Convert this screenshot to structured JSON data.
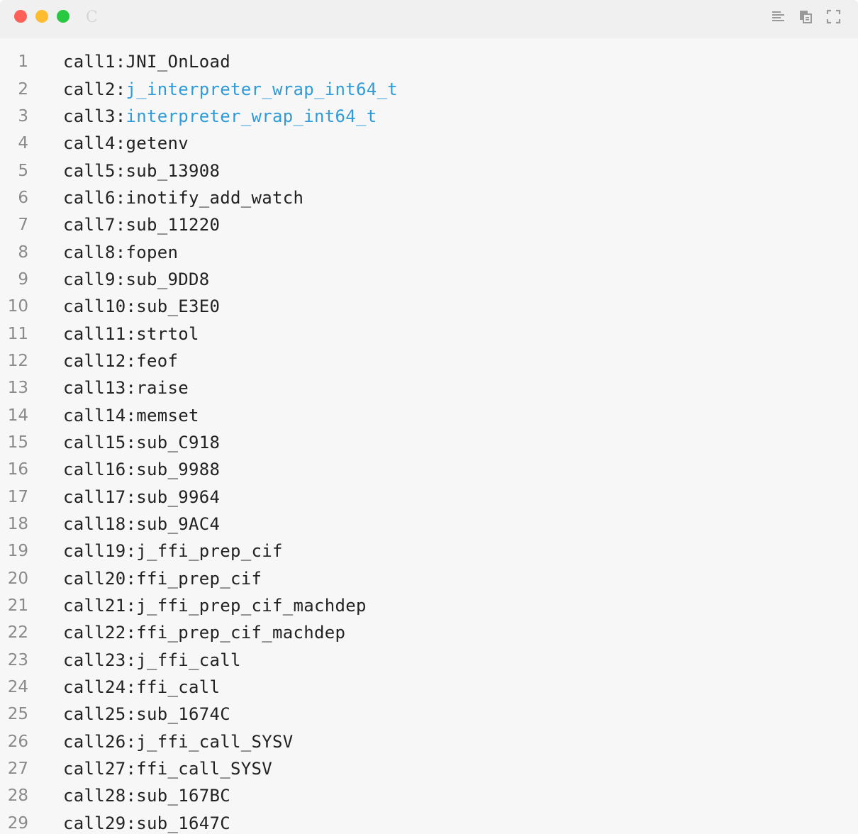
{
  "window": {
    "language_label": "C",
    "toolbar": {
      "icons": [
        "align-left-icon",
        "copy-icon",
        "fullscreen-icon"
      ]
    }
  },
  "colors": {
    "highlight": "#2f9bd9",
    "text": "#222222",
    "line_number": "#8a8a8a",
    "background": "#f7f7f7"
  },
  "code": {
    "lines": [
      {
        "num": "1",
        "prefix": "call1:",
        "name": "JNI_OnLoad",
        "highlight": false
      },
      {
        "num": "2",
        "prefix": "call2:",
        "name": "j_interpreter_wrap_int64_t",
        "highlight": true
      },
      {
        "num": "3",
        "prefix": "call3:",
        "name": "interpreter_wrap_int64_t",
        "highlight": true
      },
      {
        "num": "4",
        "prefix": "call4:",
        "name": "getenv",
        "highlight": false
      },
      {
        "num": "5",
        "prefix": "call5:",
        "name": "sub_13908",
        "highlight": false
      },
      {
        "num": "6",
        "prefix": "call6:",
        "name": "inotify_add_watch",
        "highlight": false
      },
      {
        "num": "7",
        "prefix": "call7:",
        "name": "sub_11220",
        "highlight": false
      },
      {
        "num": "8",
        "prefix": "call8:",
        "name": "fopen",
        "highlight": false
      },
      {
        "num": "9",
        "prefix": "call9:",
        "name": "sub_9DD8",
        "highlight": false
      },
      {
        "num": "10",
        "prefix": "call10:",
        "name": "sub_E3E0",
        "highlight": false
      },
      {
        "num": "11",
        "prefix": "call11:",
        "name": "strtol",
        "highlight": false
      },
      {
        "num": "12",
        "prefix": "call12:",
        "name": "feof",
        "highlight": false
      },
      {
        "num": "13",
        "prefix": "call13:",
        "name": "raise",
        "highlight": false
      },
      {
        "num": "14",
        "prefix": "call14:",
        "name": "memset",
        "highlight": false
      },
      {
        "num": "15",
        "prefix": "call15:",
        "name": "sub_C918",
        "highlight": false
      },
      {
        "num": "16",
        "prefix": "call16:",
        "name": "sub_9988",
        "highlight": false
      },
      {
        "num": "17",
        "prefix": "call17:",
        "name": "sub_9964",
        "highlight": false
      },
      {
        "num": "18",
        "prefix": "call18:",
        "name": "sub_9AC4",
        "highlight": false
      },
      {
        "num": "19",
        "prefix": "call19:",
        "name": "j_ffi_prep_cif",
        "highlight": false
      },
      {
        "num": "20",
        "prefix": "call20:",
        "name": "ffi_prep_cif",
        "highlight": false
      },
      {
        "num": "21",
        "prefix": "call21:",
        "name": "j_ffi_prep_cif_machdep",
        "highlight": false
      },
      {
        "num": "22",
        "prefix": "call22:",
        "name": "ffi_prep_cif_machdep",
        "highlight": false
      },
      {
        "num": "23",
        "prefix": "call23:",
        "name": "j_ffi_call",
        "highlight": false
      },
      {
        "num": "24",
        "prefix": "call24:",
        "name": "ffi_call",
        "highlight": false
      },
      {
        "num": "25",
        "prefix": "call25:",
        "name": "sub_1674C",
        "highlight": false
      },
      {
        "num": "26",
        "prefix": "call26:",
        "name": "j_ffi_call_SYSV",
        "highlight": false
      },
      {
        "num": "27",
        "prefix": "call27:",
        "name": "ffi_call_SYSV",
        "highlight": false
      },
      {
        "num": "28",
        "prefix": "call28:",
        "name": "sub_167BC",
        "highlight": false
      },
      {
        "num": "29",
        "prefix": "call29:",
        "name": "sub_1647C",
        "highlight": false
      }
    ]
  }
}
